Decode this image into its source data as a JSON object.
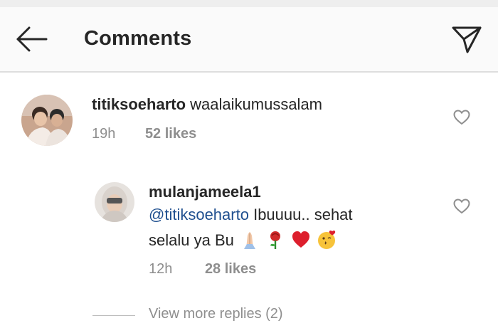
{
  "header": {
    "title": "Comments",
    "back_icon": "arrow-left-icon",
    "share_icon": "paper-plane-icon"
  },
  "comments": [
    {
      "username": "titiksoeharto",
      "text": "waalaikumussalam",
      "time": "19h",
      "likes": "52 likes"
    },
    {
      "username": "mulanjameela1",
      "mention": "@titiksoeharto",
      "text_line1": "Ibuuuu.. sehat",
      "text_line2": "selalu ya Bu",
      "emojis": [
        "folded-hands-icon",
        "rose-icon",
        "red-heart-icon",
        "kissing-face-icon"
      ],
      "time": "12h",
      "likes": "28 likes"
    }
  ],
  "view_more_replies": "View more replies (2)",
  "colors": {
    "text": "#262626",
    "secondary": "#8e8e8e",
    "mention": "#1f4f8f",
    "header_bg": "#fafafa"
  }
}
